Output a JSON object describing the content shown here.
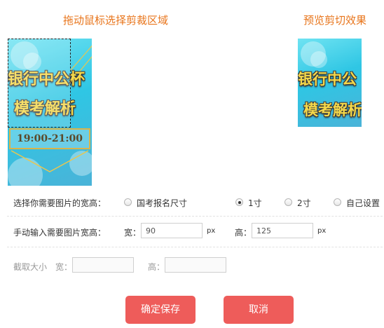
{
  "header": {
    "crop_title": "拖动鼠标选择剪裁区域",
    "preview_title": "预览剪切效果"
  },
  "image": {
    "line1": "银行中公杯",
    "line2": "模考解析",
    "time": "19:00-21:00",
    "preview_line1": "银行中公",
    "preview_line2": "模考解析"
  },
  "size_row": {
    "label": "选择你需要图片的宽高：",
    "options": [
      {
        "label": "国考报名尺寸",
        "checked": false
      },
      {
        "label": "1寸",
        "checked": true
      },
      {
        "label": "2寸",
        "checked": false
      },
      {
        "label": "自己设置",
        "checked": false
      }
    ]
  },
  "manual_row": {
    "label": "手动输入需要图片宽高：",
    "width_label": "宽：",
    "width_value": "90",
    "width_unit": "px",
    "height_label": "高：",
    "height_value": "125",
    "height_unit": "px"
  },
  "crop_row": {
    "label": "截取大小",
    "width_label": "宽：",
    "width_value": "",
    "height_label": "高：",
    "height_value": ""
  },
  "buttons": {
    "confirm": "确定保存",
    "cancel": "取消"
  },
  "colors": {
    "title_orange": "#e8741a",
    "button_red": "#ee5c5a"
  }
}
